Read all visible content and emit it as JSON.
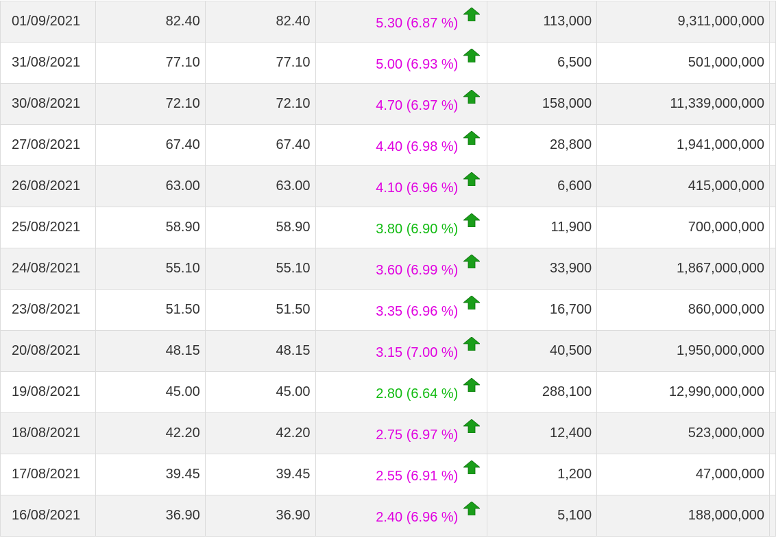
{
  "colors": {
    "change_ceiling": "#e000e0",
    "change_up": "#11bb11",
    "arrow_up": "#1a9e1a",
    "row_alt": "#f2f2f2",
    "border": "#dcdcdc",
    "text": "#333333"
  },
  "icons": {
    "change_indicator": "arrow-up-icon"
  },
  "rows": [
    {
      "date": "01/09/2021",
      "close": "82.40",
      "ref": "82.40",
      "change": "5.30 (6.87 %)",
      "change_color": "ceiling",
      "volume": "113,000",
      "value": "9,311,000,000"
    },
    {
      "date": "31/08/2021",
      "close": "77.10",
      "ref": "77.10",
      "change": "5.00 (6.93 %)",
      "change_color": "ceiling",
      "volume": "6,500",
      "value": "501,000,000"
    },
    {
      "date": "30/08/2021",
      "close": "72.10",
      "ref": "72.10",
      "change": "4.70 (6.97 %)",
      "change_color": "ceiling",
      "volume": "158,000",
      "value": "11,339,000,000"
    },
    {
      "date": "27/08/2021",
      "close": "67.40",
      "ref": "67.40",
      "change": "4.40 (6.98 %)",
      "change_color": "ceiling",
      "volume": "28,800",
      "value": "1,941,000,000"
    },
    {
      "date": "26/08/2021",
      "close": "63.00",
      "ref": "63.00",
      "change": "4.10 (6.96 %)",
      "change_color": "ceiling",
      "volume": "6,600",
      "value": "415,000,000"
    },
    {
      "date": "25/08/2021",
      "close": "58.90",
      "ref": "58.90",
      "change": "3.80 (6.90 %)",
      "change_color": "up",
      "volume": "11,900",
      "value": "700,000,000"
    },
    {
      "date": "24/08/2021",
      "close": "55.10",
      "ref": "55.10",
      "change": "3.60 (6.99 %)",
      "change_color": "ceiling",
      "volume": "33,900",
      "value": "1,867,000,000"
    },
    {
      "date": "23/08/2021",
      "close": "51.50",
      "ref": "51.50",
      "change": "3.35 (6.96 %)",
      "change_color": "ceiling",
      "volume": "16,700",
      "value": "860,000,000"
    },
    {
      "date": "20/08/2021",
      "close": "48.15",
      "ref": "48.15",
      "change": "3.15 (7.00 %)",
      "change_color": "ceiling",
      "volume": "40,500",
      "value": "1,950,000,000"
    },
    {
      "date": "19/08/2021",
      "close": "45.00",
      "ref": "45.00",
      "change": "2.80 (6.64 %)",
      "change_color": "up",
      "volume": "288,100",
      "value": "12,990,000,000"
    },
    {
      "date": "18/08/2021",
      "close": "42.20",
      "ref": "42.20",
      "change": "2.75 (6.97 %)",
      "change_color": "ceiling",
      "volume": "12,400",
      "value": "523,000,000"
    },
    {
      "date": "17/08/2021",
      "close": "39.45",
      "ref": "39.45",
      "change": "2.55 (6.91 %)",
      "change_color": "ceiling",
      "volume": "1,200",
      "value": "47,000,000"
    },
    {
      "date": "16/08/2021",
      "close": "36.90",
      "ref": "36.90",
      "change": "2.40 (6.96 %)",
      "change_color": "ceiling",
      "volume": "5,100",
      "value": "188,000,000"
    }
  ]
}
